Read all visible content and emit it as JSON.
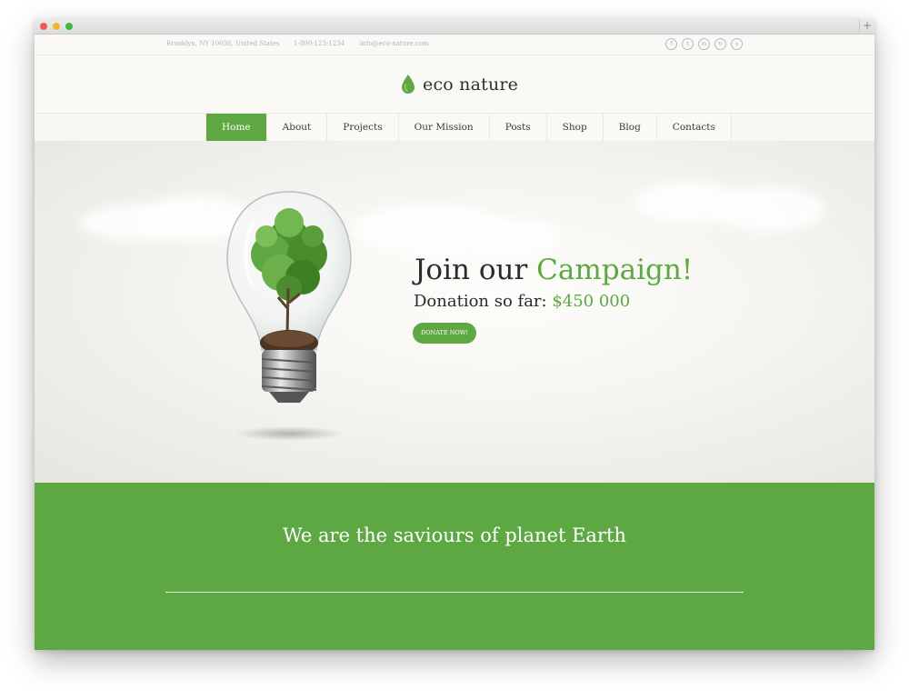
{
  "window": {
    "new_tab_symbol": "+"
  },
  "topbar": {
    "address": "Brooklyn, NY 10036, United States",
    "phone": "1-800-123-1234",
    "email": "info@eco-nature.com",
    "social_icons": [
      "facebook-icon",
      "twitter-icon",
      "linkedin-icon",
      "share-icon",
      "vimeo-icon"
    ],
    "social_glyphs": [
      "f",
      "t",
      "in",
      "↻",
      "v"
    ]
  },
  "header": {
    "logo_text": "eco nature"
  },
  "nav": {
    "items": [
      "Home",
      "About",
      "Projects",
      "Our Mission",
      "Posts",
      "Shop",
      "Blog",
      "Contacts"
    ],
    "active_index": 0
  },
  "hero": {
    "title_plain": "Join our",
    "title_accent": "Campaign!",
    "donation_label": "Donation so far:",
    "donation_amount": "$450 000",
    "button_label": "DONATE NOW!"
  },
  "band": {
    "heading": "We are the saviours of planet Earth"
  },
  "colors": {
    "accent_green": "#5ea843",
    "text_dark": "#2b2b2b",
    "muted": "#b3b3b3"
  }
}
